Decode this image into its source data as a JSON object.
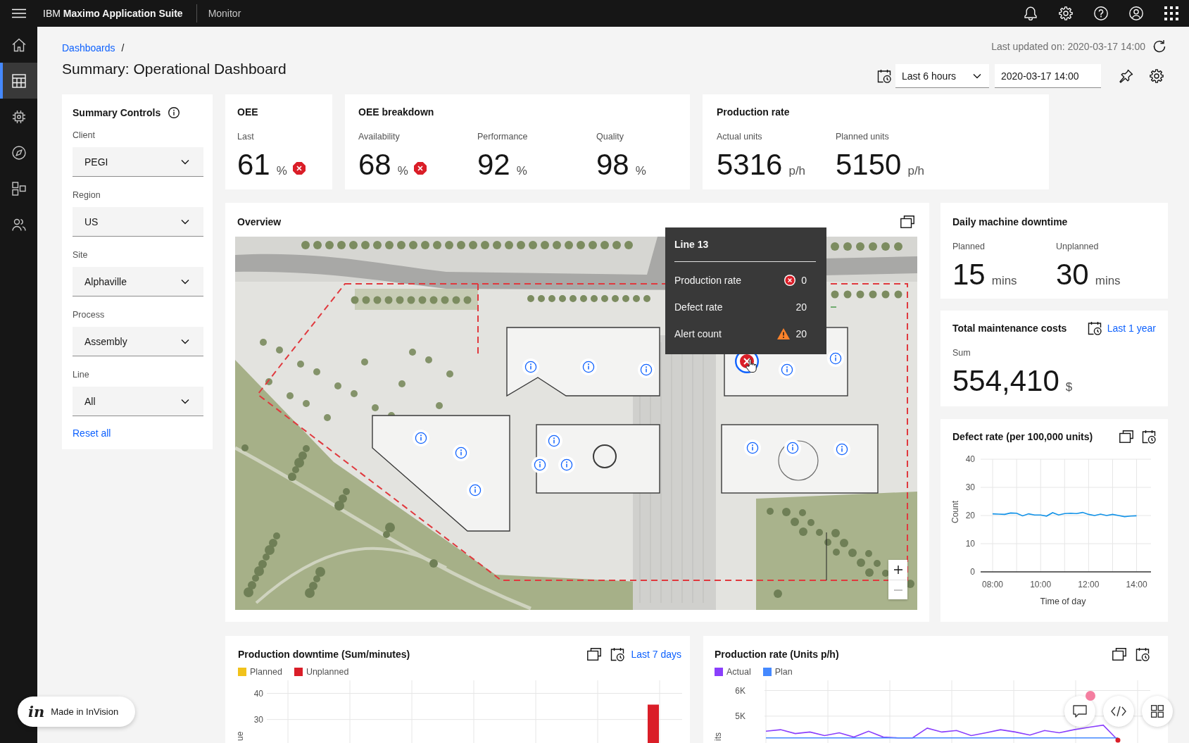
{
  "top_bar": {
    "brand": "IBM **Maximo Application Suite**",
    "app": "Monitor"
  },
  "side_nav": {
    "items": [
      {
        "selected": false
      },
      {
        "selected": true
      },
      {
        "selected": false
      },
      {
        "selected": false
      },
      {
        "selected": false
      },
      {
        "selected": false
      }
    ]
  },
  "header": {
    "breadcrumb": "Dashboards",
    "separator": "/",
    "title": "Summary: Operational Dashboard",
    "last_updated": "Last updated on: 2020-03-17 14:00",
    "time_range": "Last 6 hours",
    "date": "2020-03-17 14:00"
  },
  "summary_controls": {
    "title": "Summary Controls",
    "fields": [
      {
        "label": "Client",
        "value": "PEGI"
      },
      {
        "label": "Region",
        "value": "US"
      },
      {
        "label": "Site",
        "value": "Alphaville"
      },
      {
        "label": "Process",
        "value": "Assembly"
      },
      {
        "label": "Line",
        "value": "All"
      }
    ],
    "reset": "Reset all"
  },
  "kpi_cards": [
    {
      "title": "OEE",
      "metrics": [
        {
          "label": "Last",
          "value": "61",
          "unit": "%",
          "error": true
        }
      ]
    },
    {
      "title": "OEE breakdown",
      "metrics": [
        {
          "label": "Availability",
          "value": "68",
          "unit": "%",
          "error": true
        },
        {
          "label": "Performance",
          "value": "92",
          "unit": "%",
          "error": false
        },
        {
          "label": "Quality",
          "value": "98",
          "unit": "%",
          "error": false
        }
      ]
    },
    {
      "title": "Production rate",
      "metrics": [
        {
          "label": "Actual units",
          "value": "5316",
          "unit": "p/h",
          "error": false
        },
        {
          "label": "Planned units",
          "value": "5150",
          "unit": "p/h",
          "error": false
        }
      ]
    }
  ],
  "overview": {
    "title": "Overview",
    "markers": [
      {
        "selected": false
      },
      {
        "selected": false
      },
      {
        "selected": false
      },
      {
        "selected": true
      },
      {
        "selected": false
      },
      {
        "selected": false
      },
      {
        "selected": false
      },
      {
        "selected": false
      },
      {
        "selected": false
      },
      {
        "selected": false
      },
      {
        "selected": false
      },
      {
        "selected": false
      },
      {
        "selected": false
      },
      {
        "selected": false
      },
      {
        "selected": false
      }
    ],
    "map_controls": [
      {
        "kind": "zoom_in",
        "disabled": false
      },
      {
        "kind": "zoom_out",
        "disabled": true
      }
    ],
    "tooltip": {
      "title": "Line 13",
      "rows": [
        {
          "label": "Production rate",
          "value": "0",
          "error": true,
          "warning": false
        },
        {
          "label": "Defect rate",
          "value": "20",
          "error": false,
          "warning": false
        },
        {
          "label": "Alert count",
          "value": "20",
          "error": false,
          "warning": true
        }
      ]
    }
  },
  "side_cards": [
    {
      "title": "Daily machine downtime",
      "metrics": [
        {
          "label": "Planned",
          "value": "15",
          "unit": "mins"
        },
        {
          "label": "Unplanned",
          "value": "30",
          "unit": "mins"
        }
      ]
    },
    {
      "title": "Total maintenance costs",
      "range": "Last 1 year",
      "metrics": [
        {
          "label": "Sum",
          "value": "554,410",
          "unit": "$"
        }
      ]
    }
  ],
  "defect_rate": {
    "title": "Defect rate (per 100,000 units)",
    "chart_data": {
      "type": "line",
      "xlabel": "Time of day",
      "ylabel": "Count",
      "x": [
        8,
        8.25,
        8.5,
        8.75,
        9,
        9.25,
        9.5,
        9.75,
        10,
        10.25,
        10.5,
        10.75,
        11,
        11.25,
        11.5,
        11.75,
        12,
        12.25,
        12.5,
        12.75,
        13,
        13.25,
        13.5,
        13.75,
        14
      ],
      "series": [
        {
          "color": "#1192e8",
          "values": [
            20.6,
            20.5,
            20.4,
            20.9,
            20.8,
            19.9,
            20.6,
            20.2,
            20.2,
            19.8,
            21.0,
            20.2,
            20.7,
            20.8,
            20.7,
            21.1,
            20.4,
            20.0,
            20.5,
            20.0,
            20.4,
            20.0,
            19.6,
            19.8,
            19.9
          ]
        }
      ],
      "xlim": [
        7.5,
        14.6
      ],
      "ylim": [
        0,
        40
      ],
      "xticks": [
        {
          "value": 8,
          "label": "08:00"
        },
        {
          "value": 10,
          "label": "10:00"
        },
        {
          "value": 12,
          "label": "12:00"
        },
        {
          "value": 14,
          "label": "14:00"
        }
      ],
      "yticks": [
        0,
        10,
        20,
        30,
        40
      ],
      "grid": true
    }
  },
  "bottom_cards": [
    {
      "title": "Production downtime (Sum/minutes)",
      "range": "Last 7 days",
      "chart_data": {
        "type": "bar",
        "ylabel": "ue",
        "series": [
          {
            "name": "Planned",
            "color": "#f1c21b",
            "values": [
              null,
              null,
              null,
              null,
              null,
              null,
              null
            ]
          },
          {
            "name": "Unplanned",
            "color": "#da1e28",
            "values": [
              null,
              null,
              null,
              null,
              null,
              null,
              35.7
            ]
          }
        ],
        "ylim": [
          21,
          45
        ],
        "yticks": [
          30,
          40
        ],
        "grid": true
      }
    },
    {
      "title": "Production rate (Units p/h)",
      "chart_data": {
        "type": "line",
        "ylabel": "its",
        "series": [
          {
            "name": "Actual",
            "color": "#8a3ffc",
            "values": [
              4410,
              4470,
              4320,
              4380,
              4240,
              4350,
              4180,
              4410,
              4180,
              4150,
              4150,
              4530,
              4380,
              4440,
              4240,
              4350,
              4470,
              4380,
              4260,
              4440,
              4350,
              4470,
              4560,
              4650,
              4060
            ]
          },
          {
            "name": "Plan",
            "color": "#4589ff",
            "values": [
              4150,
              4150,
              4150,
              4150,
              4150,
              4150,
              4150,
              4150,
              4150,
              4150,
              4150,
              4150,
              4150,
              4150,
              4150,
              4150,
              4150,
              4150,
              4150,
              4150,
              4150,
              4150,
              4150,
              4150,
              4150
            ]
          }
        ],
        "ylim": [
          3950,
          6400
        ],
        "yticks": [
          {
            "value": 5000,
            "label": "5K"
          },
          {
            "value": 6000,
            "label": "6K"
          }
        ],
        "grid": true
      }
    }
  ],
  "invision": {
    "logo": "in",
    "label": "Made in InVision"
  }
}
